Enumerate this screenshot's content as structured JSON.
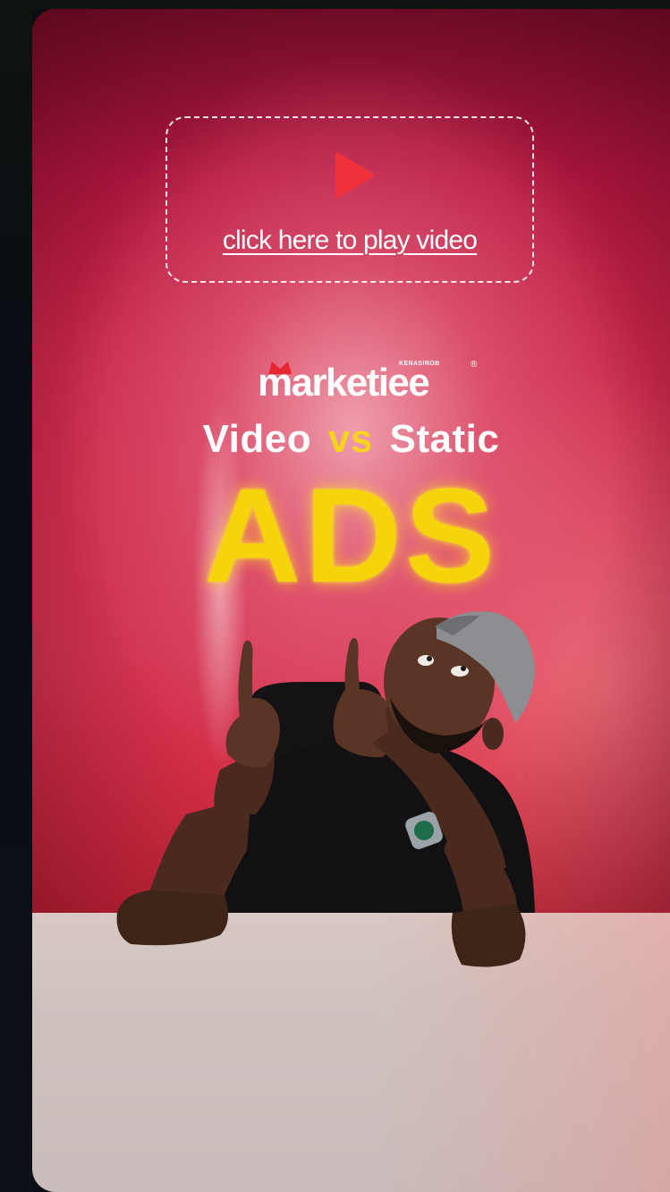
{
  "player": {
    "play_link_text": "click here to play video",
    "play_icon": "play-icon",
    "accent_color": "#f0303a"
  },
  "brand": {
    "small_label": "KENASIROB",
    "name": "marketiee",
    "registered_mark": "®"
  },
  "headline": {
    "word1": "Video",
    "vs": "vs",
    "word2": "Static",
    "big_word": "ADS",
    "highlight_color": "#f5d40d"
  }
}
